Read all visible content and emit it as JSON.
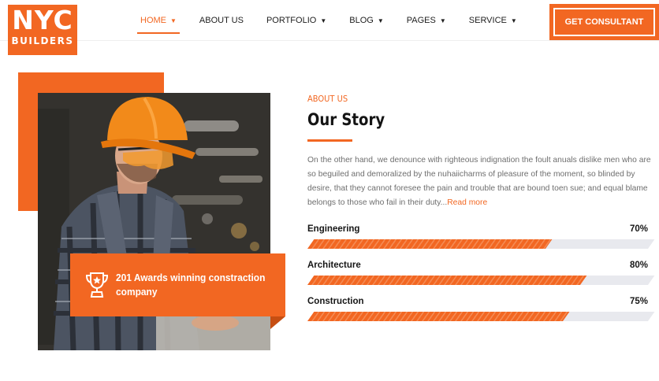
{
  "brand": {
    "line1": "NYC",
    "line2": "BUILDERS",
    "color": "#f26722"
  },
  "nav": {
    "items": [
      {
        "label": "HOME",
        "active": true
      },
      {
        "label": "ABOUT US"
      },
      {
        "label": "PORTFOLIO"
      },
      {
        "label": "BLOG"
      },
      {
        "label": "PAGES"
      },
      {
        "label": "SERVICE"
      }
    ],
    "dropdown_icon": "chevron-down-icon"
  },
  "cta": {
    "label": "GET CONSULTANT"
  },
  "award": {
    "icon": "trophy-icon",
    "text": "201 Awards winning constraction company"
  },
  "about": {
    "eyebrow": "ABOUT US",
    "title": "Our Story",
    "paragraph": "On the other hand, we denounce with righteous indignation the foult anuals dislike men who are so beguiled and demoralized by the nuhaiicharms of pleasure of the moment, so blinded by desire, that they cannot foresee the pain and trouble that are bound toen sue; and equal blame belongs to those who fail in their duty...",
    "read_more": "Read more"
  },
  "skills": [
    {
      "label": "Engineering",
      "percent": "70%",
      "value": 70
    },
    {
      "label": "Architecture",
      "percent": "80%",
      "value": 80
    },
    {
      "label": "Construction",
      "percent": "75%",
      "value": 75
    }
  ]
}
